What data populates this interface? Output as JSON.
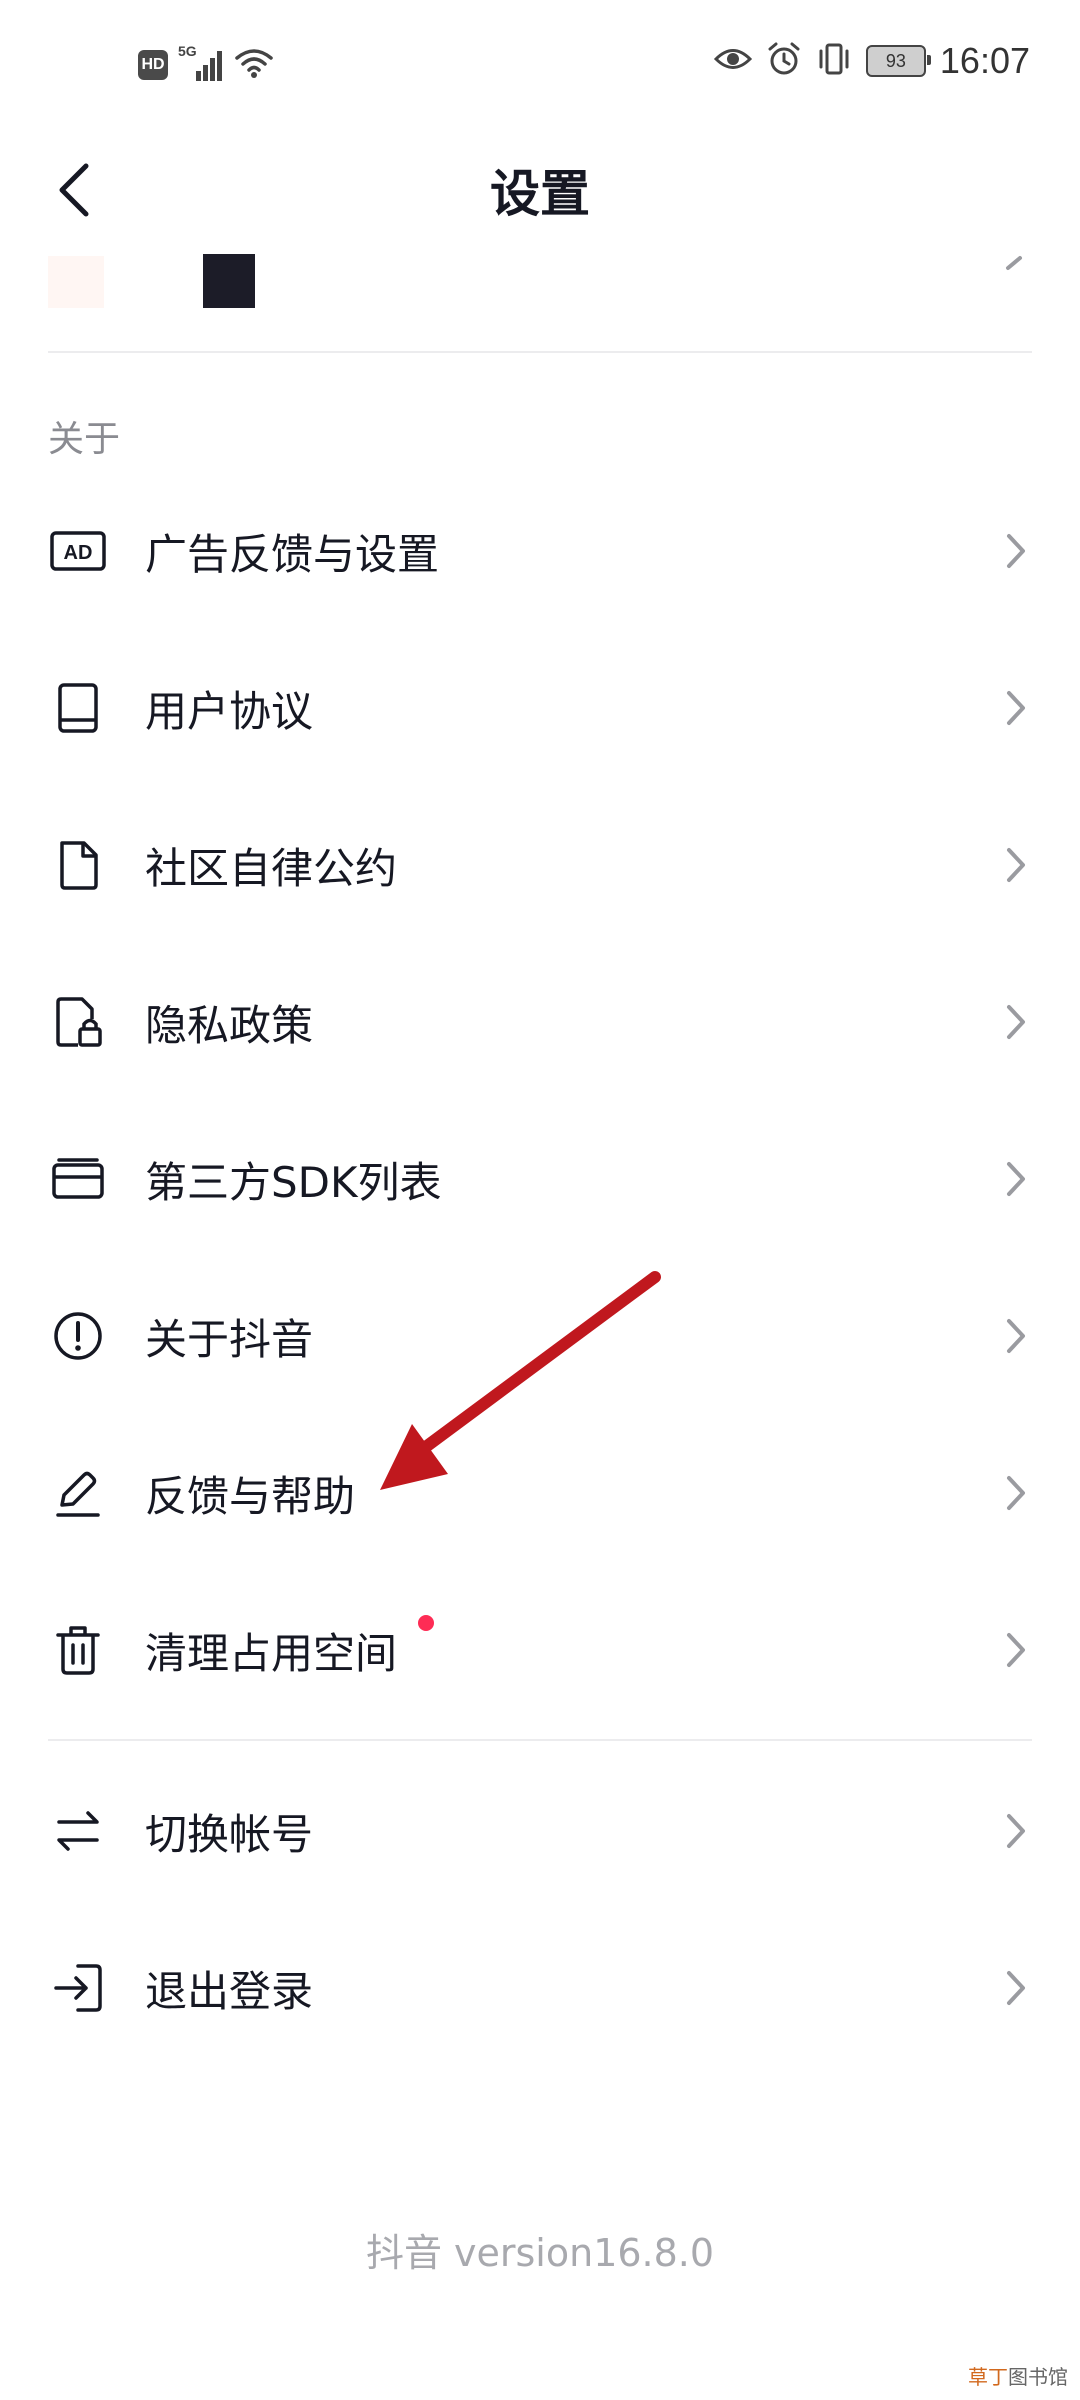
{
  "status_bar": {
    "hd": "HD",
    "network": "5G",
    "battery": "93",
    "time": "16:07"
  },
  "header": {
    "title": "设置",
    "back_icon": "back-arrow-icon"
  },
  "section_about": {
    "title": "关于",
    "items": [
      {
        "label": "广告反馈与设置",
        "icon": "ad-icon"
      },
      {
        "label": "用户协议",
        "icon": "book-icon"
      },
      {
        "label": "社区自律公约",
        "icon": "document-icon"
      },
      {
        "label": "隐私政策",
        "icon": "privacy-lock-icon"
      },
      {
        "label": "第三方SDK列表",
        "icon": "card-icon"
      },
      {
        "label": "关于抖音",
        "icon": "info-icon"
      },
      {
        "label": "反馈与帮助",
        "icon": "pencil-icon"
      },
      {
        "label": "清理占用空间",
        "icon": "trash-icon",
        "has_dot": true
      }
    ]
  },
  "account_items": [
    {
      "label": "切换帐号",
      "icon": "switch-icon"
    },
    {
      "label": "退出登录",
      "icon": "logout-icon"
    }
  ],
  "footer": {
    "version": "抖音 version16.8.0"
  },
  "watermark": {
    "part_a": "草丁",
    "part_b": "图书馆"
  },
  "colors": {
    "text": "#161823",
    "secondary": "#8a8b91",
    "accent_dot": "#fe2c55",
    "annotation_arrow": "#c0181e"
  }
}
